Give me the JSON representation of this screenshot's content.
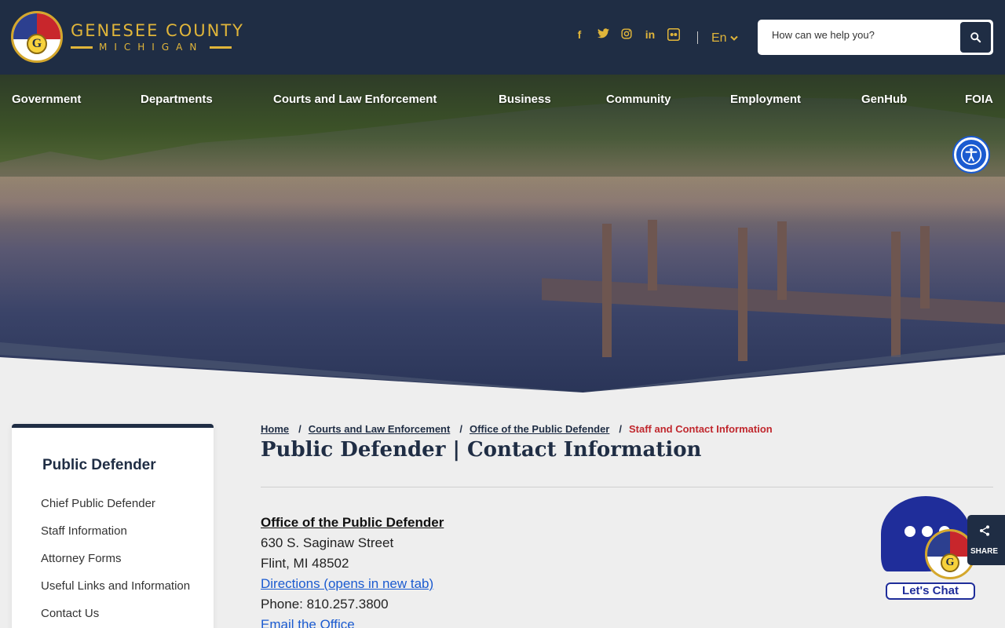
{
  "header": {
    "logo": {
      "line1": "GENESEE COUNTY",
      "line2": "MICHIGAN",
      "seal_letter": "G"
    },
    "social_icons": [
      "facebook-icon",
      "twitter-icon",
      "instagram-icon",
      "linkedin-icon",
      "flickr-icon"
    ],
    "language": "En",
    "search": {
      "placeholder": "How can we help you?"
    }
  },
  "nav": {
    "items": [
      {
        "label": "Government"
      },
      {
        "label": "Departments"
      },
      {
        "label": "Courts and Law Enforcement"
      },
      {
        "label": "Business"
      },
      {
        "label": "Community"
      },
      {
        "label": "Employment"
      },
      {
        "label": "GenHub"
      },
      {
        "label": "FOIA"
      }
    ]
  },
  "sidebar": {
    "title": "Public Defender",
    "items": [
      {
        "label": "Chief Public Defender"
      },
      {
        "label": "Staff Information"
      },
      {
        "label": "Attorney Forms"
      },
      {
        "label": "Useful Links and Information"
      },
      {
        "label": "Contact Us"
      }
    ]
  },
  "breadcrumb": {
    "items": [
      {
        "label": "Home"
      },
      {
        "label": "Courts and Law Enforcement"
      },
      {
        "label": "Office of the Public Defender"
      }
    ],
    "current": "Staff and Contact Information"
  },
  "main": {
    "title": "Public Defender | Contact Information",
    "office": {
      "name": "Office of the Public Defender",
      "street": "630 S. Saginaw Street",
      "city": "Flint, MI 48502",
      "directions_link": "Directions (opens in new tab)",
      "phone": "Phone: 810.257.3800",
      "email_link": "Email the Office"
    }
  },
  "chat": {
    "label": "Let's Chat"
  },
  "share": {
    "label": "SHARE"
  },
  "colors": {
    "navy": "#1f2d44",
    "gold": "#e0b53a",
    "accent_red": "#c0272d",
    "link_blue": "#1b5bd0"
  }
}
